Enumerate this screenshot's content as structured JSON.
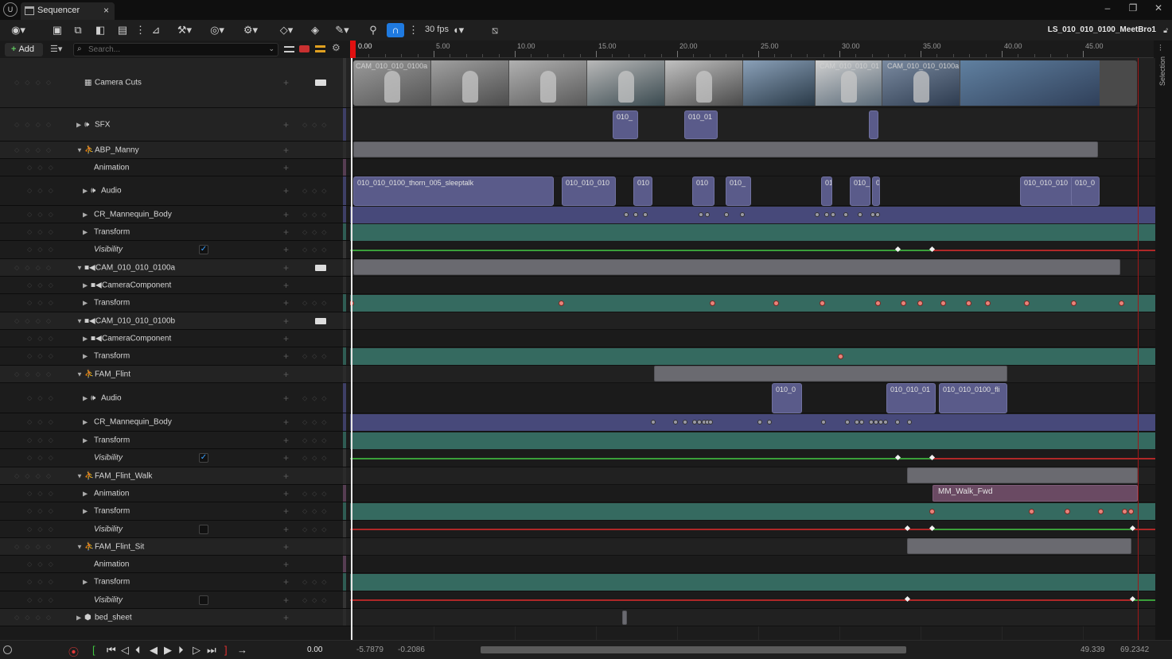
{
  "window": {
    "tab_title": "Sequencer",
    "tab_close": "×",
    "sequence_name": "LS_010_010_0100_MeetBro1",
    "min": "–",
    "restore": "❐",
    "close": "✕"
  },
  "toolbar": {
    "fps": "30 fps"
  },
  "filterbar": {
    "add_label": "Add",
    "search_placeholder": "Search..."
  },
  "ruler": {
    "current_time": "0.00",
    "ticks": [
      "5.00",
      "10.00",
      "15.00",
      "20.00",
      "25.00",
      "30.00",
      "35.00",
      "40.00",
      "45.00"
    ]
  },
  "tracks": [
    {
      "label": "Camera Cuts"
    },
    {
      "label": "SFX"
    },
    {
      "label": "ABP_Manny"
    },
    {
      "label": "Animation"
    },
    {
      "label": "Audio"
    },
    {
      "label": "CR_Mannequin_Body"
    },
    {
      "label": "Transform"
    },
    {
      "label": "Visibility"
    },
    {
      "label": "CAM_010_010_0100a"
    },
    {
      "label": "CameraComponent"
    },
    {
      "label": "Transform"
    },
    {
      "label": "CAM_010_010_0100b"
    },
    {
      "label": "CameraComponent"
    },
    {
      "label": "Transform"
    },
    {
      "label": "FAM_Flint"
    },
    {
      "label": "Audio"
    },
    {
      "label": "CR_Mannequin_Body"
    },
    {
      "label": "Transform"
    },
    {
      "label": "Visibility"
    },
    {
      "label": "FAM_Flint_Walk"
    },
    {
      "label": "Animation"
    },
    {
      "label": "Transform"
    },
    {
      "label": "Visibility"
    },
    {
      "label": "FAM_Flint_Sit"
    },
    {
      "label": "Animation"
    },
    {
      "label": "Transform"
    },
    {
      "label": "Visibility"
    },
    {
      "label": "bed_sheet"
    }
  ],
  "camera_cuts": {
    "labels": [
      "CAM_010_010_0100a",
      "CAM_010_010_01",
      "CAM_010_010_0100a"
    ]
  },
  "sections": {
    "sfx": [
      "010_",
      "010_01"
    ],
    "manny_audio": [
      "010_010_0100_thorn_005_sleeptalk",
      "010_010_010",
      "010",
      "010",
      "010_",
      "010",
      "010_010_010",
      "010_0"
    ],
    "flint_audio": [
      "010_0",
      "010_010_01",
      "010_010_0100_fli"
    ],
    "walk_anim": "MM_Walk_Fwd"
  },
  "bottom": {
    "current_time": "0.00",
    "view_start": "-5.7879",
    "view_start2": "-0.2086",
    "view_end": "49.339",
    "view_end2": "69.2342"
  },
  "right_panel": {
    "label": "Selection"
  },
  "colors": {
    "accent": "#1f7ae0",
    "playhead": "#e01010",
    "visibility_on": "#3aa03a",
    "visibility_off": "#b02828"
  }
}
